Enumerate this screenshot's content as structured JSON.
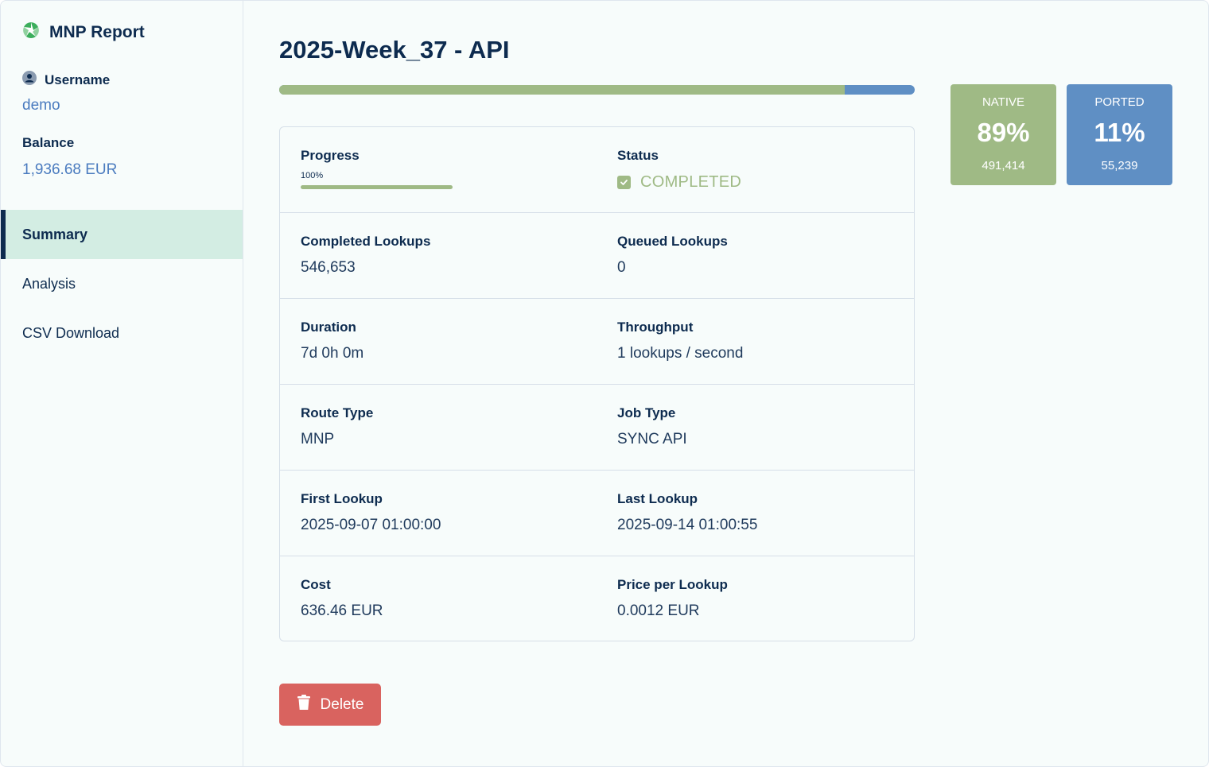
{
  "app": {
    "title": "MNP Report"
  },
  "sidebar": {
    "username_label": "Username",
    "username_value": "demo",
    "balance_label": "Balance",
    "balance_value": "1,936.68 EUR",
    "items": [
      {
        "label": "Summary",
        "active": true
      },
      {
        "label": "Analysis",
        "active": false
      },
      {
        "label": "CSV Download",
        "active": false
      }
    ]
  },
  "main": {
    "title": "2025-Week_37 - API",
    "distribution": {
      "native_fraction": 0.89,
      "ported_fraction": 0.11
    },
    "progress": {
      "label": "Progress",
      "percent_text": "100%",
      "percent": 100
    },
    "status": {
      "label": "Status",
      "value": "COMPLETED"
    },
    "rows": [
      {
        "left_label": "Completed Lookups",
        "left_value": "546,653",
        "right_label": "Queued Lookups",
        "right_value": "0"
      },
      {
        "left_label": "Duration",
        "left_value": "7d 0h 0m",
        "right_label": "Throughput",
        "right_value": "1 lookups / second"
      },
      {
        "left_label": "Route Type",
        "left_value": "MNP",
        "right_label": "Job Type",
        "right_value": "SYNC API"
      },
      {
        "left_label": "First Lookup",
        "left_value": "2025-09-07 01:00:00",
        "right_label": "Last Lookup",
        "right_value": "2025-09-14 01:00:55"
      },
      {
        "left_label": "Cost",
        "left_value": "636.46 EUR",
        "right_label": "Price per Lookup",
        "right_value": "0.0012 EUR"
      }
    ],
    "delete_label": "Delete"
  },
  "tiles": {
    "native": {
      "label": "NATIVE",
      "percent": "89%",
      "count": "491,414"
    },
    "ported": {
      "label": "PORTED",
      "percent": "11%",
      "count": "55,239"
    }
  },
  "colors": {
    "native": "#9fba85",
    "ported": "#5f8fc4",
    "danger": "#d9635f",
    "navy": "#0d2b4f",
    "link": "#4a7bbf"
  },
  "icons": {
    "brand": "aperture-icon",
    "user": "user-circle-icon",
    "status": "check-square-icon",
    "delete": "trash-icon"
  }
}
